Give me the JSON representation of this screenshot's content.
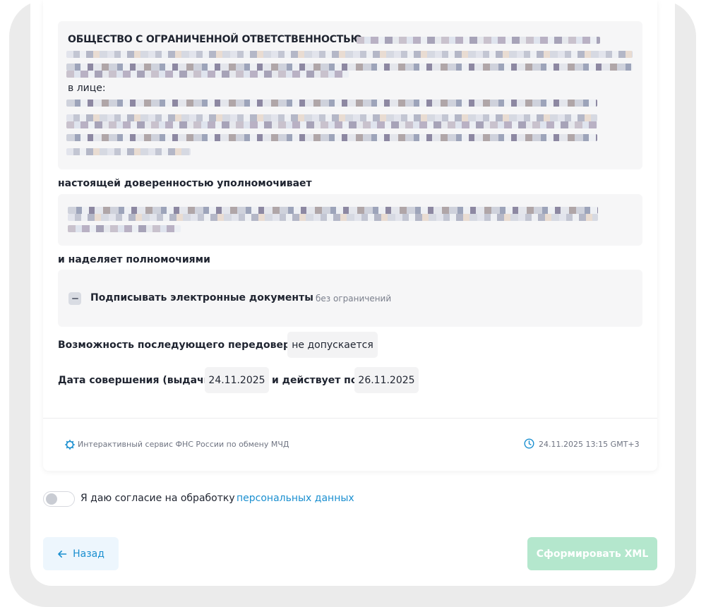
{
  "principal": {
    "org_name": "ОБЩЕСТВО С ОГРАНИЧЕННОЙ ОТВЕТСТВЕННОСТЬЮ",
    "represented_by_label": "в лице:"
  },
  "labels": {
    "authorizes": "настоящей доверенностью уполномочивает",
    "grants_powers": "и наделяет полномочиями",
    "redelegation": "Возможность последующего передоверия",
    "issue_date": "Дата совершения (выдачи)",
    "valid_until": "и действует по"
  },
  "powers": [
    {
      "title": "Подписывать электронные документы",
      "scope": "без ограничений"
    }
  ],
  "values": {
    "redelegation": "не допускается",
    "issue_date": "24.11.2025",
    "valid_until": "26.11.2025"
  },
  "footer": {
    "service": "Интерактивный сервис ФНС России по обмену МЧД",
    "timestamp": "24.11.2025 13:15 GMT+3"
  },
  "consent": {
    "text": "Я даю согласие на обработку",
    "link": "персональных данных",
    "checked": false
  },
  "buttons": {
    "back": "Назад",
    "generate": "Сформировать XML"
  },
  "colors": {
    "accent": "#1a8fd0",
    "primary_disabled": "#b4e7cd"
  },
  "icons": {
    "back": "arrow-left-icon",
    "service": "gear-icon",
    "time": "clock-icon",
    "collapse": "minus-icon"
  }
}
